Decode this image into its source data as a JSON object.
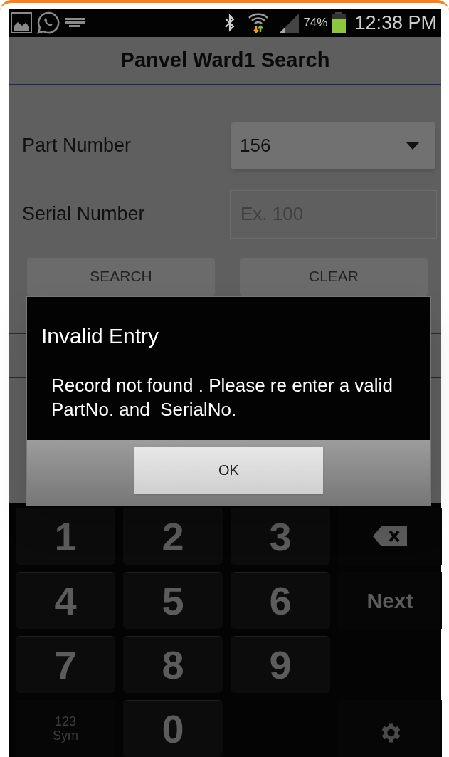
{
  "status_bar": {
    "battery_percent": "74%",
    "battery": {
      "level": 0.74
    },
    "time": "12:38 PM"
  },
  "title": "Panvel Ward1 Search",
  "form": {
    "part_number": {
      "label": "Part Number",
      "value": "156"
    },
    "serial_number": {
      "label": "Serial Number",
      "placeholder": "Ex. 100"
    },
    "buttons": [
      "SEARCH",
      "CLEAR"
    ]
  },
  "dialog": {
    "title": "Invalid Entry",
    "message": "Record not found . Please re enter a valid PartNo. and  SerialNo.",
    "button": "OK"
  },
  "keyboard": {
    "rows": [
      [
        {
          "kind": "digit",
          "label": "1"
        },
        {
          "kind": "digit",
          "label": "2"
        },
        {
          "kind": "digit",
          "label": "3"
        },
        {
          "kind": "backspace"
        }
      ],
      [
        {
          "kind": "digit",
          "label": "4"
        },
        {
          "kind": "digit",
          "label": "5"
        },
        {
          "kind": "digit",
          "label": "6"
        },
        {
          "kind": "action",
          "label": "Next"
        }
      ],
      [
        {
          "kind": "digit",
          "label": "7"
        },
        {
          "kind": "digit",
          "label": "8"
        },
        {
          "kind": "digit",
          "label": "9"
        },
        {
          "kind": "spacer"
        }
      ],
      [
        {
          "kind": "symbols",
          "label": "123",
          "sublabel": "Sym"
        },
        {
          "kind": "digit",
          "label": "0"
        },
        {
          "kind": "spacer"
        },
        {
          "kind": "settings"
        }
      ]
    ]
  }
}
